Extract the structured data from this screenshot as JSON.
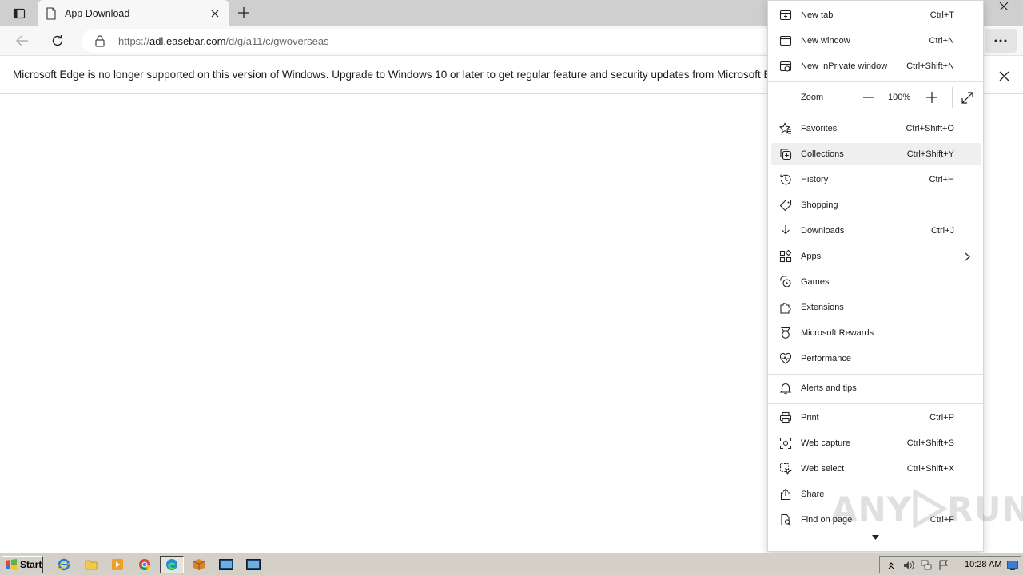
{
  "tab": {
    "title": "App Download"
  },
  "address_bar": {
    "url_prefix": "https://",
    "url_host": "adl.easebar.com",
    "url_path": "/d/g/a11/c/gwoverseas"
  },
  "infobar": {
    "message": "Microsoft Edge is no longer supported on this version of Windows. Upgrade to Windows 10 or later to get regular feature and security updates from Microsoft Edge."
  },
  "menu": {
    "new_tab": {
      "label": "New tab",
      "shortcut": "Ctrl+T"
    },
    "new_window": {
      "label": "New window",
      "shortcut": "Ctrl+N"
    },
    "inprivate": {
      "label": "New InPrivate window",
      "shortcut": "Ctrl+Shift+N"
    },
    "zoom": {
      "label": "Zoom",
      "value": "100%"
    },
    "favorites": {
      "label": "Favorites",
      "shortcut": "Ctrl+Shift+O"
    },
    "collections": {
      "label": "Collections",
      "shortcut": "Ctrl+Shift+Y"
    },
    "history": {
      "label": "History",
      "shortcut": "Ctrl+H"
    },
    "shopping": {
      "label": "Shopping"
    },
    "downloads": {
      "label": "Downloads",
      "shortcut": "Ctrl+J"
    },
    "apps": {
      "label": "Apps"
    },
    "games": {
      "label": "Games"
    },
    "extensions": {
      "label": "Extensions"
    },
    "rewards": {
      "label": "Microsoft Rewards"
    },
    "performance": {
      "label": "Performance"
    },
    "alerts": {
      "label": "Alerts and tips"
    },
    "print": {
      "label": "Print",
      "shortcut": "Ctrl+P"
    },
    "web_capture": {
      "label": "Web capture",
      "shortcut": "Ctrl+Shift+S"
    },
    "web_select": {
      "label": "Web select",
      "shortcut": "Ctrl+Shift+X"
    },
    "share": {
      "label": "Share"
    },
    "find": {
      "label": "Find on page",
      "shortcut": "Ctrl+F"
    }
  },
  "watermark": {
    "left": "ANY",
    "right": "RUN"
  },
  "taskbar": {
    "start_label": "Start",
    "clock": "10:28 AM"
  },
  "colors": {
    "accent": "#0078d4",
    "tabstrip": "#cfcfcf",
    "toolbar": "#f7f7f7",
    "taskbar": "#d4d0c8"
  }
}
